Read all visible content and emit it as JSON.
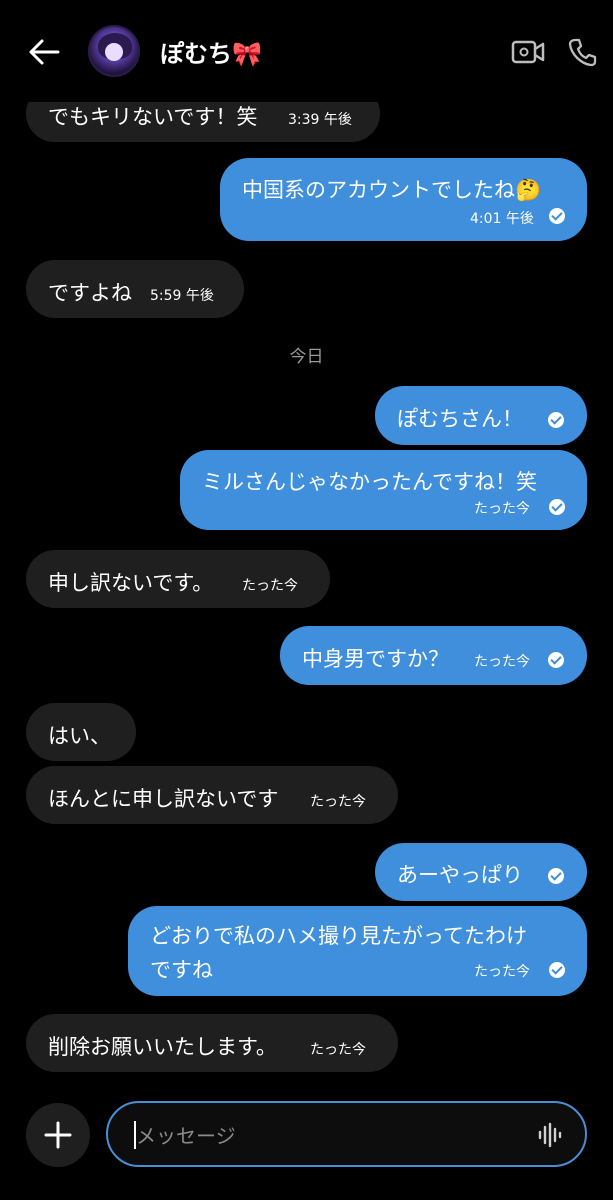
{
  "header": {
    "contact_name": "ぽむち🎀",
    "icons": {
      "back": "back-arrow-icon",
      "video": "video-call-icon",
      "phone": "phone-call-icon"
    }
  },
  "messages": [
    {
      "dir": "in",
      "text": "でもキリないです！笑",
      "time": "3:39 午後"
    },
    {
      "dir": "out",
      "text": "中国系のアカウントでしたね🤔",
      "time": "4:01 午後",
      "read": true
    },
    {
      "dir": "in",
      "text": "ですよね",
      "time": "5:59 午後"
    },
    {
      "dir": "out",
      "text": "ぽむちさん！",
      "time": "",
      "read": true
    },
    {
      "dir": "out",
      "text": "ミルさんじゃなかったんですね！笑",
      "time": "たった今",
      "read": true
    },
    {
      "dir": "in",
      "text": "申し訳ないです。",
      "time": "たった今"
    },
    {
      "dir": "out",
      "text": "中身男ですか？",
      "time": "たった今",
      "read": true
    },
    {
      "dir": "in",
      "text": "はい、",
      "time": ""
    },
    {
      "dir": "in",
      "text": "ほんとに申し訳ないです",
      "time": "たった今"
    },
    {
      "dir": "out",
      "text": "あーやっぱり",
      "time": "",
      "read": true
    },
    {
      "dir": "out",
      "text_line1": "どおりで私のハメ撮り見たがってたわけ",
      "text_line2": "ですね",
      "time": "たった今",
      "read": true
    },
    {
      "dir": "in",
      "text": "削除お願いいたします。",
      "time": "たった今"
    }
  ],
  "day_separator": "今日",
  "composer": {
    "placeholder": "メッセージ",
    "icons": {
      "add": "plus-icon",
      "voice": "voice-waveform-icon"
    }
  },
  "colors": {
    "background": "#000000",
    "incoming_bubble": "#1f1f1f",
    "outgoing_bubble": "#3f8fdc",
    "input_border": "#4b8ed6"
  }
}
